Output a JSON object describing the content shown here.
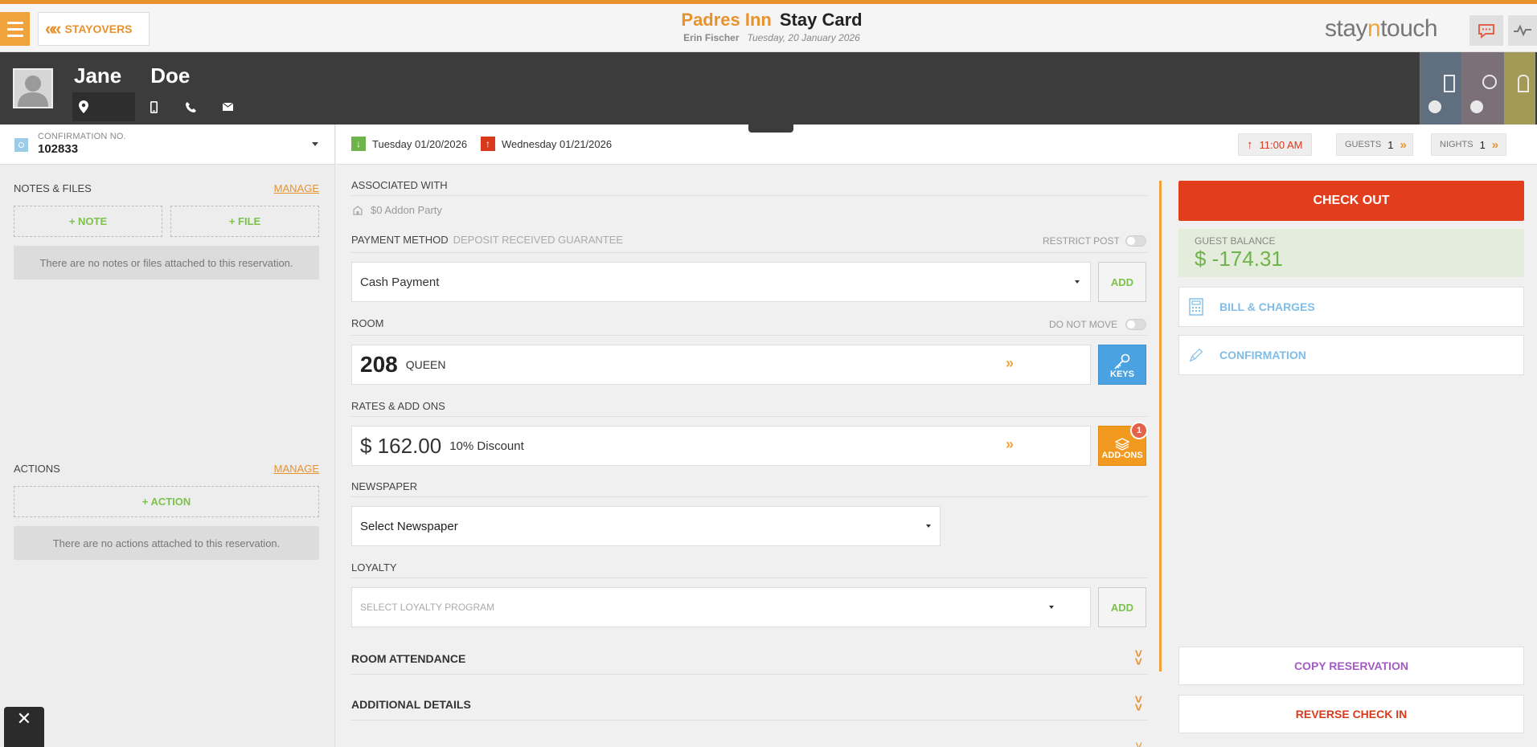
{
  "header": {
    "back_label": "STAYOVERS",
    "hotel_name": "Padres Inn",
    "page_title": "Stay Card",
    "user_name": "Erin Fischer",
    "business_date": "Tuesday, 20 January 2026",
    "logo_prefix": "stay",
    "logo_accent": "n",
    "logo_suffix": "touch"
  },
  "guest": {
    "first_name": "Jane",
    "last_name": "Doe"
  },
  "reservation": {
    "confirmation_label": "CONFIRMATION NO.",
    "confirmation_no": "102833"
  },
  "notes": {
    "title": "NOTES & FILES",
    "manage_label": "MANAGE",
    "add_note": "+ NOTE",
    "add_file": "+ FILE",
    "empty_text": "There are no notes or files attached to this reservation."
  },
  "actions": {
    "title": "ACTIONS",
    "manage_label": "MANAGE",
    "add_action": "+ ACTION",
    "empty_text": "There are no actions attached to this reservation."
  },
  "dates": {
    "arrival": "Tuesday 01/20/2026",
    "departure": "Wednesday 01/21/2026",
    "departure_time": "11:00 AM",
    "guests_label": "GUESTS",
    "guests_value": "1",
    "nights_label": "NIGHTS",
    "nights_value": "1"
  },
  "main": {
    "associated_label": "ASSOCIATED WITH",
    "associated_value": "$0 Addon Party",
    "payment_label": "PAYMENT METHOD",
    "payment_sub": "DEPOSIT RECEIVED GUARANTEE",
    "restrict_post_label": "RESTRICT POST",
    "payment_value": "Cash Payment",
    "add_label": "ADD",
    "room_label": "ROOM",
    "do_not_move_label": "DO NOT MOVE",
    "room_number": "208",
    "room_type": "QUEEN",
    "keys_label": "KEYS",
    "rates_label": "RATES & ADD ONS",
    "rate_amount": "$ 162.00",
    "rate_name": "10% Discount",
    "addons_label": "ADD-ONS",
    "addons_count": "1",
    "newspaper_label": "NEWSPAPER",
    "newspaper_value": "Select Newspaper",
    "loyalty_label": "LOYALTY",
    "loyalty_placeholder": "SELECT LOYALTY PROGRAM",
    "room_attendance_label": "ROOM ATTENDANCE",
    "additional_details_label": "ADDITIONAL DETAILS"
  },
  "side": {
    "checkout_label": "CHECK OUT",
    "balance_label": "GUEST BALANCE",
    "balance_value": "$ -174.31",
    "bill_label": "BILL & CHARGES",
    "confirmation_label": "CONFIRMATION",
    "copy_label": "COPY RESERVATION",
    "reverse_label": "REVERSE CHECK IN"
  },
  "colors": {
    "accent": "#e8922e",
    "checkout": "#e23d1c",
    "balance": "#6fb44a",
    "link": "#7fbde6",
    "copy": "#a45bc4",
    "reverse": "#d93a1c"
  },
  "icons": [
    "menu-icon",
    "back-chevron-icon",
    "chat-icon",
    "pulse-icon",
    "avatar-icon",
    "location-icon",
    "mobile-icon",
    "phone-icon",
    "email-icon",
    "confirmation-icon",
    "arrival-arrow-icon",
    "departure-arrow-icon",
    "building-icon",
    "key-icon",
    "layers-icon",
    "calculator-icon",
    "pen-icon",
    "close-icon"
  ]
}
